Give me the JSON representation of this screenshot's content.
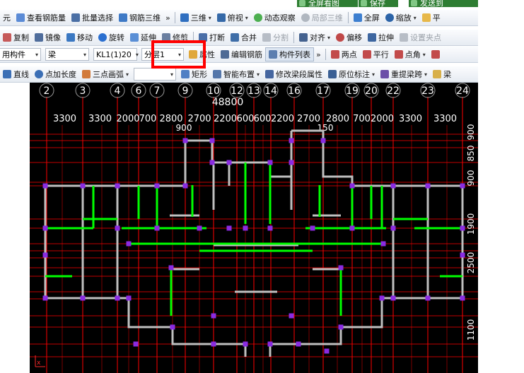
{
  "top": {
    "fullscreen": "全屏看图",
    "save": "保存",
    "send": "发送到"
  },
  "row1": {
    "items": [
      "元",
      "查看钢筋量",
      "批量选择",
      "钢筋三维",
      "三维",
      "俯视",
      "动态观察",
      "局部三维",
      "全屏",
      "缩放",
      "平"
    ]
  },
  "row2": {
    "items": [
      "复制",
      "镜像",
      "移动",
      "旋转",
      "延伸",
      "修剪",
      "打断",
      "合并",
      "分割",
      "对齐",
      "偏移",
      "拉伸",
      "设置夹点"
    ]
  },
  "row3": {
    "combo_type": "用构件",
    "combo_member": "梁",
    "combo_name": "KL1(1)20",
    "combo_layer": "分层1",
    "items": [
      "属性",
      "编辑钢筋",
      "构件列表",
      "两点",
      "平行",
      "点角"
    ]
  },
  "row4": {
    "items": [
      "直线",
      "点加长度",
      "三点画弧",
      "矩形",
      "智能布置",
      "修改梁段属性",
      "原位标注",
      "重提梁跨",
      "梁"
    ]
  },
  "drawing": {
    "axes": [
      "2",
      "3",
      "4",
      "6",
      "7",
      "9",
      "10",
      "12",
      "13",
      "14",
      "16",
      "17",
      "19",
      "20",
      "22",
      "23",
      "24"
    ],
    "total_dim": "48800",
    "spans": [
      "3300",
      "3300",
      "2000",
      "700",
      "2800",
      "2700",
      "2200",
      "600",
      "600",
      "2200",
      "2700",
      "2800",
      "700",
      "2000",
      "3300",
      "3300"
    ],
    "sub_dims": [
      "900",
      "150"
    ],
    "right_dims": [
      "900",
      "850",
      "900",
      "1900",
      "2500",
      "1100"
    ]
  },
  "colors": {
    "canvas": "#000000",
    "gridline": "#ff0000",
    "wall": "#bfbfbf",
    "beam": "#00ff00",
    "column": "#8a2be2",
    "highlight": "#ff0000"
  }
}
